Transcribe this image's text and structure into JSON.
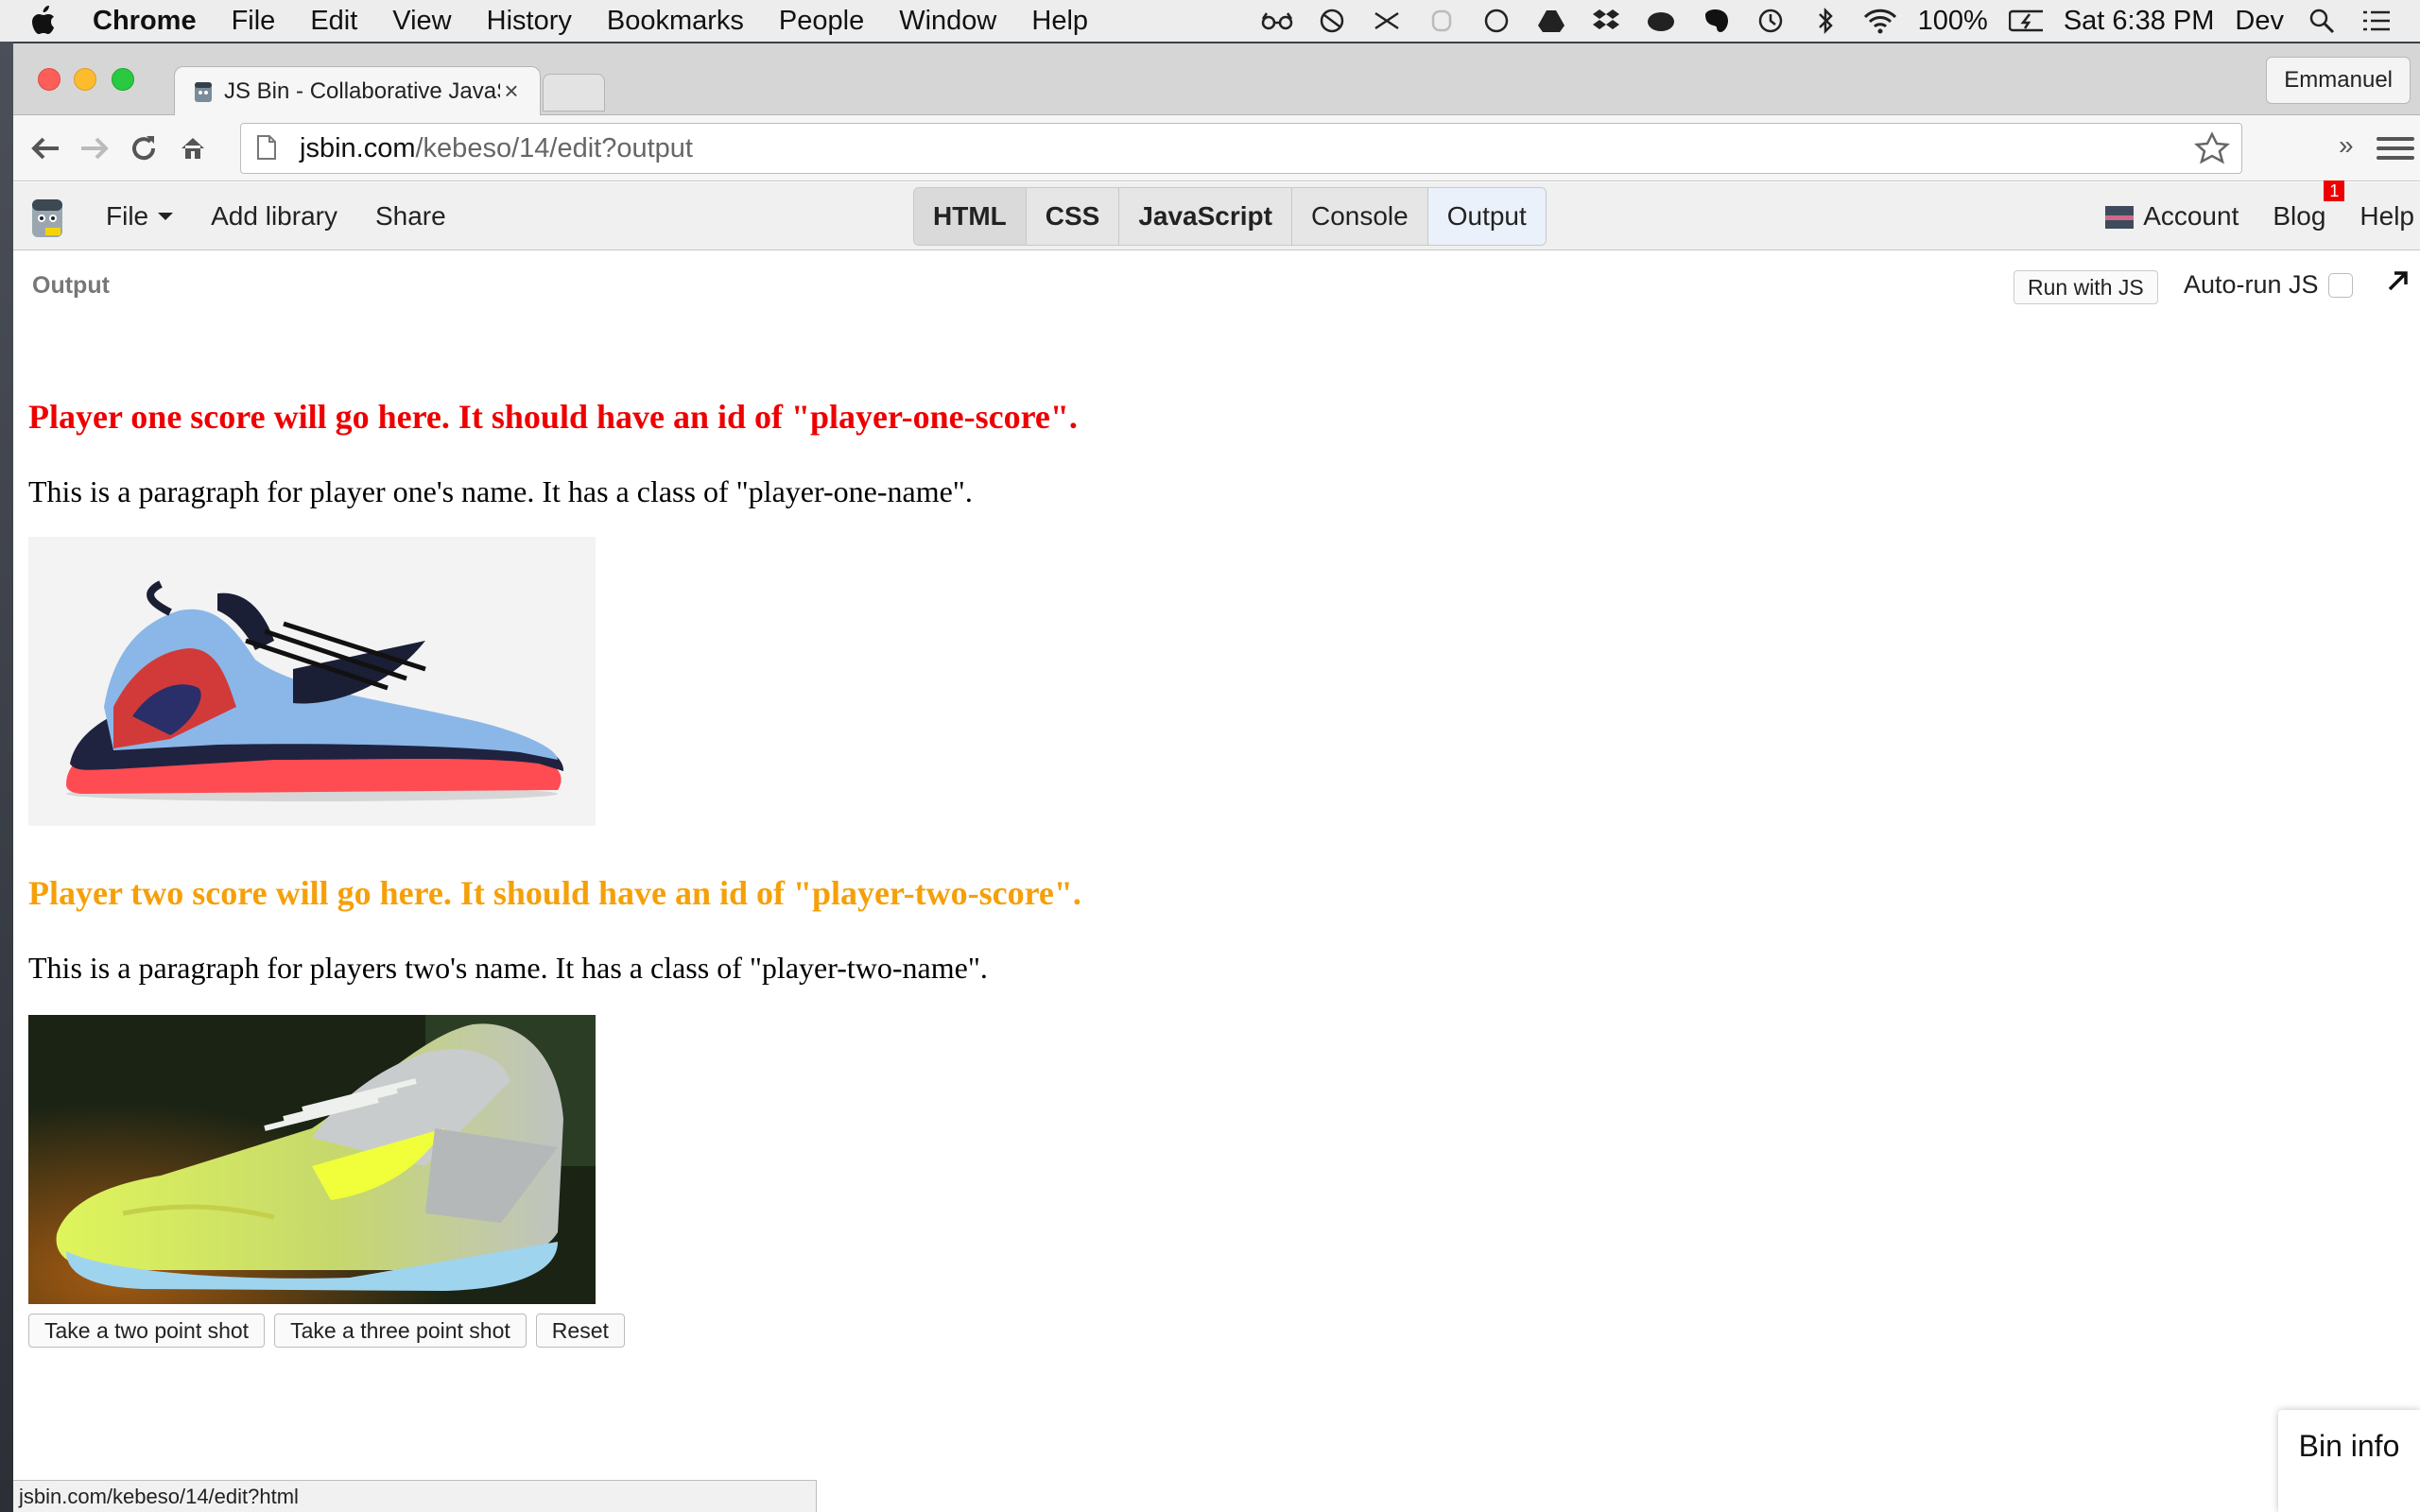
{
  "menubar": {
    "app_name": "Chrome",
    "items": [
      "File",
      "Edit",
      "View",
      "History",
      "Bookmarks",
      "People",
      "Window",
      "Help"
    ],
    "battery": "100%",
    "clock": "Sat 6:38 PM",
    "user": "Dev"
  },
  "browser": {
    "tab_title": "JS Bin - Collaborative JavaScript Debugging",
    "profile_name": "Emmanuel",
    "url_host": "jsbin.com",
    "url_path": "/kebeso/14/edit?output",
    "status_url": "jsbin.com/kebeso/14/edit?html"
  },
  "jsbin": {
    "file_label": "File",
    "add_library": "Add library",
    "share": "Share",
    "panels": [
      "HTML",
      "CSS",
      "JavaScript",
      "Console",
      "Output"
    ],
    "account": "Account",
    "blog": "Blog",
    "blog_badge": "1",
    "help": "Help",
    "output_label": "Output",
    "run_with_js": "Run with JS",
    "auto_run": "Auto-run JS",
    "bin_info": "Bin info"
  },
  "output_page": {
    "player_one_score": "Player one score will go here. It should have an id of \"player-one-score\".",
    "player_one_name": "This is a paragraph for player one's name. It has a class of \"player-one-name\".",
    "player_two_score": "Player two score will go here. It should have an id of \"player-two-score\".",
    "player_two_name": "This is a paragraph for players two's name. It has a class of \"player-two-name\".",
    "buttons": [
      "Take a two point shot",
      "Take a three point shot",
      "Reset"
    ]
  },
  "colors": {
    "player_one_score": "#ee0000",
    "player_two_score": "#f5a00a"
  }
}
